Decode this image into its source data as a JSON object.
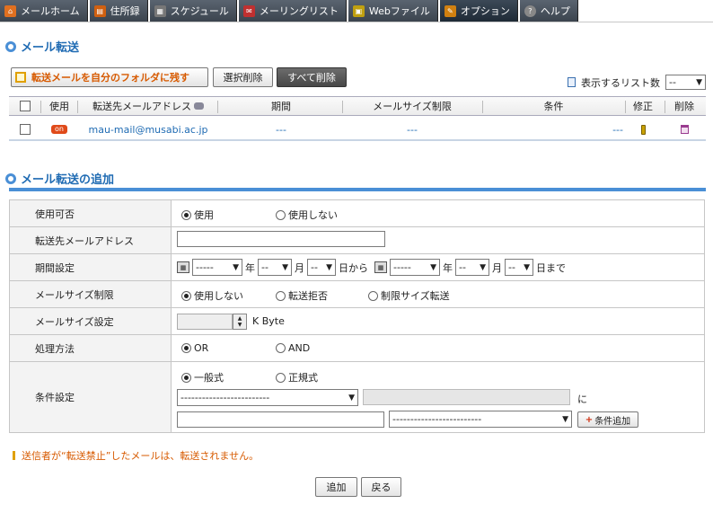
{
  "nav": {
    "tabs": [
      {
        "label": "メールホーム",
        "icon": "home-icon",
        "color": "#e07020"
      },
      {
        "label": "住所録",
        "icon": "address-book-icon",
        "color": "#d06010"
      },
      {
        "label": "スケジュール",
        "icon": "calendar-icon",
        "color": "#777"
      },
      {
        "label": "メーリングリスト",
        "icon": "mailing-list-icon",
        "color": "#c03030"
      },
      {
        "label": "Webファイル",
        "icon": "web-file-icon",
        "color": "#c0a010"
      },
      {
        "label": "オプション",
        "icon": "option-icon",
        "color": "#d08010"
      },
      {
        "label": "ヘルプ",
        "icon": "help-icon",
        "color": "#888"
      }
    ]
  },
  "forward": {
    "title": "メール転送",
    "keep_button": "転送メールを自分のフォルダに残す",
    "delete_selected": "選択削除",
    "delete_all": "すべて削除",
    "list_count_label": "表示するリスト数",
    "list_count_value": "--",
    "columns": {
      "use": "使用",
      "address": "転送先メールアドレス",
      "period": "期間",
      "size_limit": "メールサイズ制限",
      "condition": "条件",
      "edit": "修正",
      "delete": "削除"
    },
    "rows": [
      {
        "status": "on",
        "address": "mau-mail@musabi.ac.jp",
        "period": "---",
        "size_limit": "---",
        "condition": "---"
      }
    ]
  },
  "add": {
    "title": "メール転送の追加",
    "use_label": "使用可否",
    "use_yes": "使用",
    "use_no": "使用しない",
    "address_label": "転送先メールアドレス",
    "address_value": "",
    "period_label": "期間設定",
    "year_sel": "-----",
    "month_sel": "--",
    "day_sel": "--",
    "year_unit": "年",
    "month_unit": "月",
    "from_unit": "日から",
    "to_unit": "日まで",
    "size_limit_label": "メールサイズ制限",
    "size_opt1": "使用しない",
    "size_opt2": "転送拒否",
    "size_opt3": "制限サイズ転送",
    "size_setting_label": "メールサイズ設定",
    "size_unit": "K Byte",
    "process_label": "処理方法",
    "process_or": "OR",
    "process_and": "AND",
    "condition_label": "条件設定",
    "cond_general": "一般式",
    "cond_regex": "正規式",
    "cond_select1": "-------------------------",
    "cond_ni": "に",
    "cond_select2": "-------------------------",
    "add_condition": "条件追加"
  },
  "note": "送信者が“転送禁止”したメールは、転送されません。",
  "buttons": {
    "add": "追加",
    "back": "戻る"
  }
}
